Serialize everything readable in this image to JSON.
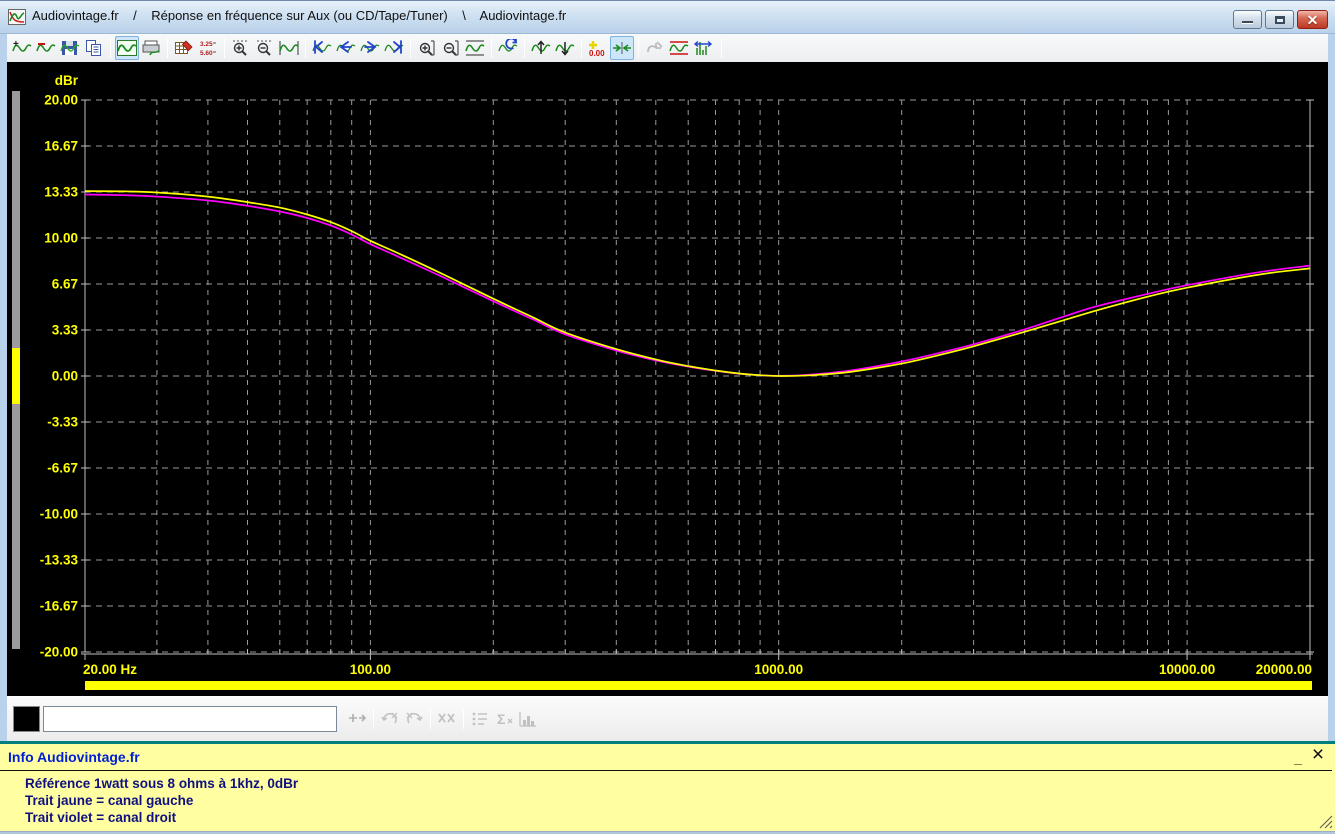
{
  "window": {
    "title": "Audiovintage.fr    /    Réponse en fréquence sur Aux (ou CD/Tape/Tuner)    \\    Audiovintage.fr",
    "app_icon": "waveform-app-icon",
    "controls": {
      "minimize": "minimize",
      "maximize": "maximize",
      "close": "close"
    }
  },
  "toolbar": {
    "icons": [
      {
        "name": "add-curve"
      },
      {
        "name": "subtract-curve"
      },
      {
        "name": "save-curve"
      },
      {
        "name": "copy-curve"
      },
      {
        "name": "sep"
      },
      {
        "name": "view-curve",
        "selected": true
      },
      {
        "name": "print-curve"
      },
      {
        "name": "sep"
      },
      {
        "name": "edit-grid"
      },
      {
        "name": "show-values"
      },
      {
        "name": "sep"
      },
      {
        "name": "zoom-time-in"
      },
      {
        "name": "zoom-time-out"
      },
      {
        "name": "fit-horizontal"
      },
      {
        "name": "sep"
      },
      {
        "name": "goto-start"
      },
      {
        "name": "step-back"
      },
      {
        "name": "step-forward"
      },
      {
        "name": "goto-end"
      },
      {
        "name": "sep"
      },
      {
        "name": "zoom-amp-in"
      },
      {
        "name": "zoom-amp-out"
      },
      {
        "name": "fit-vertical"
      },
      {
        "name": "sep"
      },
      {
        "name": "rebuild-curve"
      },
      {
        "name": "sep"
      },
      {
        "name": "scale-up"
      },
      {
        "name": "scale-down"
      },
      {
        "name": "sep"
      },
      {
        "name": "offset-zero"
      },
      {
        "name": "align-curves",
        "selected": true
      },
      {
        "name": "sep"
      },
      {
        "name": "export-curve",
        "disabled": true
      },
      {
        "name": "limit-lines"
      },
      {
        "name": "spectrum-cursors"
      },
      {
        "name": "sep",
        "end": true
      }
    ]
  },
  "chart_data": {
    "type": "line",
    "title": "Réponse en fréquence sur Aux (ou CD/Tape/Tuner)",
    "background": "#000000",
    "grid": "dashed-gray",
    "grid_color": "#9a9a9a",
    "x_axis": {
      "scale": "log",
      "min": 20,
      "max": 20000,
      "unit": "Hz",
      "ticks": [
        {
          "f": 20,
          "label": "20.00 Hz",
          "align": "start"
        },
        {
          "f": 100,
          "label": "100.00",
          "align": "middle"
        },
        {
          "f": 1000,
          "label": "1000.00",
          "align": "middle"
        },
        {
          "f": 10000,
          "label": "10000.00",
          "align": "middle"
        },
        {
          "f": 20000,
          "label": "20000.00",
          "align": "end"
        }
      ]
    },
    "y_axis": {
      "label": "dBr",
      "min": -20,
      "max": 20,
      "ticks": [
        "20.00",
        "16.67",
        "13.33",
        "10.00",
        "6.67",
        "3.33",
        "0.00",
        "-3.33",
        "-6.67",
        "-10.00",
        "-13.33",
        "-16.67",
        "-20.00"
      ]
    },
    "tick_label_color": "#ffff00",
    "series": [
      {
        "name": "canal droit",
        "color": "#ff00ff",
        "points": [
          [
            20,
            13.15
          ],
          [
            25,
            13.1
          ],
          [
            30,
            13.0
          ],
          [
            40,
            12.72
          ],
          [
            50,
            12.33
          ],
          [
            60,
            11.92
          ],
          [
            70,
            11.45
          ],
          [
            80,
            10.9
          ],
          [
            90,
            10.25
          ],
          [
            100,
            9.55
          ],
          [
            120,
            8.5
          ],
          [
            150,
            7.18
          ],
          [
            200,
            5.42
          ],
          [
            250,
            4.1
          ],
          [
            300,
            3.02
          ],
          [
            400,
            1.85
          ],
          [
            500,
            1.13
          ],
          [
            600,
            0.68
          ],
          [
            700,
            0.38
          ],
          [
            800,
            0.17
          ],
          [
            900,
            0.06
          ],
          [
            1000,
            0.01
          ],
          [
            1200,
            0.1
          ],
          [
            1500,
            0.4
          ],
          [
            2000,
            1.05
          ],
          [
            2500,
            1.7
          ],
          [
            3000,
            2.3
          ],
          [
            4000,
            3.38
          ],
          [
            5000,
            4.32
          ],
          [
            6000,
            5.05
          ],
          [
            8000,
            5.95
          ],
          [
            10000,
            6.58
          ],
          [
            15000,
            7.52
          ],
          [
            20000,
            8.0
          ]
        ]
      },
      {
        "name": "canal gauche",
        "color": "#ffff00",
        "points": [
          [
            20,
            13.4
          ],
          [
            25,
            13.38
          ],
          [
            30,
            13.3
          ],
          [
            40,
            13.0
          ],
          [
            50,
            12.6
          ],
          [
            60,
            12.2
          ],
          [
            70,
            11.7
          ],
          [
            80,
            11.15
          ],
          [
            90,
            10.5
          ],
          [
            100,
            9.8
          ],
          [
            120,
            8.75
          ],
          [
            150,
            7.4
          ],
          [
            200,
            5.6
          ],
          [
            250,
            4.25
          ],
          [
            300,
            3.15
          ],
          [
            400,
            1.95
          ],
          [
            500,
            1.2
          ],
          [
            600,
            0.72
          ],
          [
            700,
            0.4
          ],
          [
            800,
            0.18
          ],
          [
            900,
            0.06
          ],
          [
            1000,
            0.0
          ],
          [
            1200,
            0.05
          ],
          [
            1500,
            0.3
          ],
          [
            2000,
            0.9
          ],
          [
            2500,
            1.55
          ],
          [
            3000,
            2.15
          ],
          [
            4000,
            3.2
          ],
          [
            5000,
            4.05
          ],
          [
            6000,
            4.75
          ],
          [
            8000,
            5.75
          ],
          [
            10000,
            6.4
          ],
          [
            15000,
            7.35
          ],
          [
            20000,
            7.8
          ]
        ]
      }
    ],
    "legend_note": "Trait jaune = canal gauche / Trait violet = canal droit",
    "scrollbar_color": "#ffff00"
  },
  "bottombar": {
    "swatch_color": "#000000",
    "input_value": "",
    "input_placeholder": "",
    "icons": [
      {
        "name": "marker-offset",
        "disabled": true
      },
      {
        "name": "sep"
      },
      {
        "name": "undo-marker",
        "disabled": true
      },
      {
        "name": "redo-marker",
        "disabled": true
      },
      {
        "name": "sep"
      },
      {
        "name": "delete-markers",
        "disabled": true
      },
      {
        "name": "sep"
      },
      {
        "name": "marker-list",
        "disabled": true
      },
      {
        "name": "marker-sum",
        "disabled": true
      },
      {
        "name": "marker-histogram",
        "disabled": true
      }
    ]
  },
  "info_panel": {
    "header": "Info Audiovintage.fr",
    "lines": [
      "Référence 1watt sous 8 ohms à 1khz, 0dBr",
      "Trait jaune = canal gauche",
      "Trait violet = canal droit"
    ],
    "minimize_glyph": "_",
    "close_glyph": "×"
  }
}
